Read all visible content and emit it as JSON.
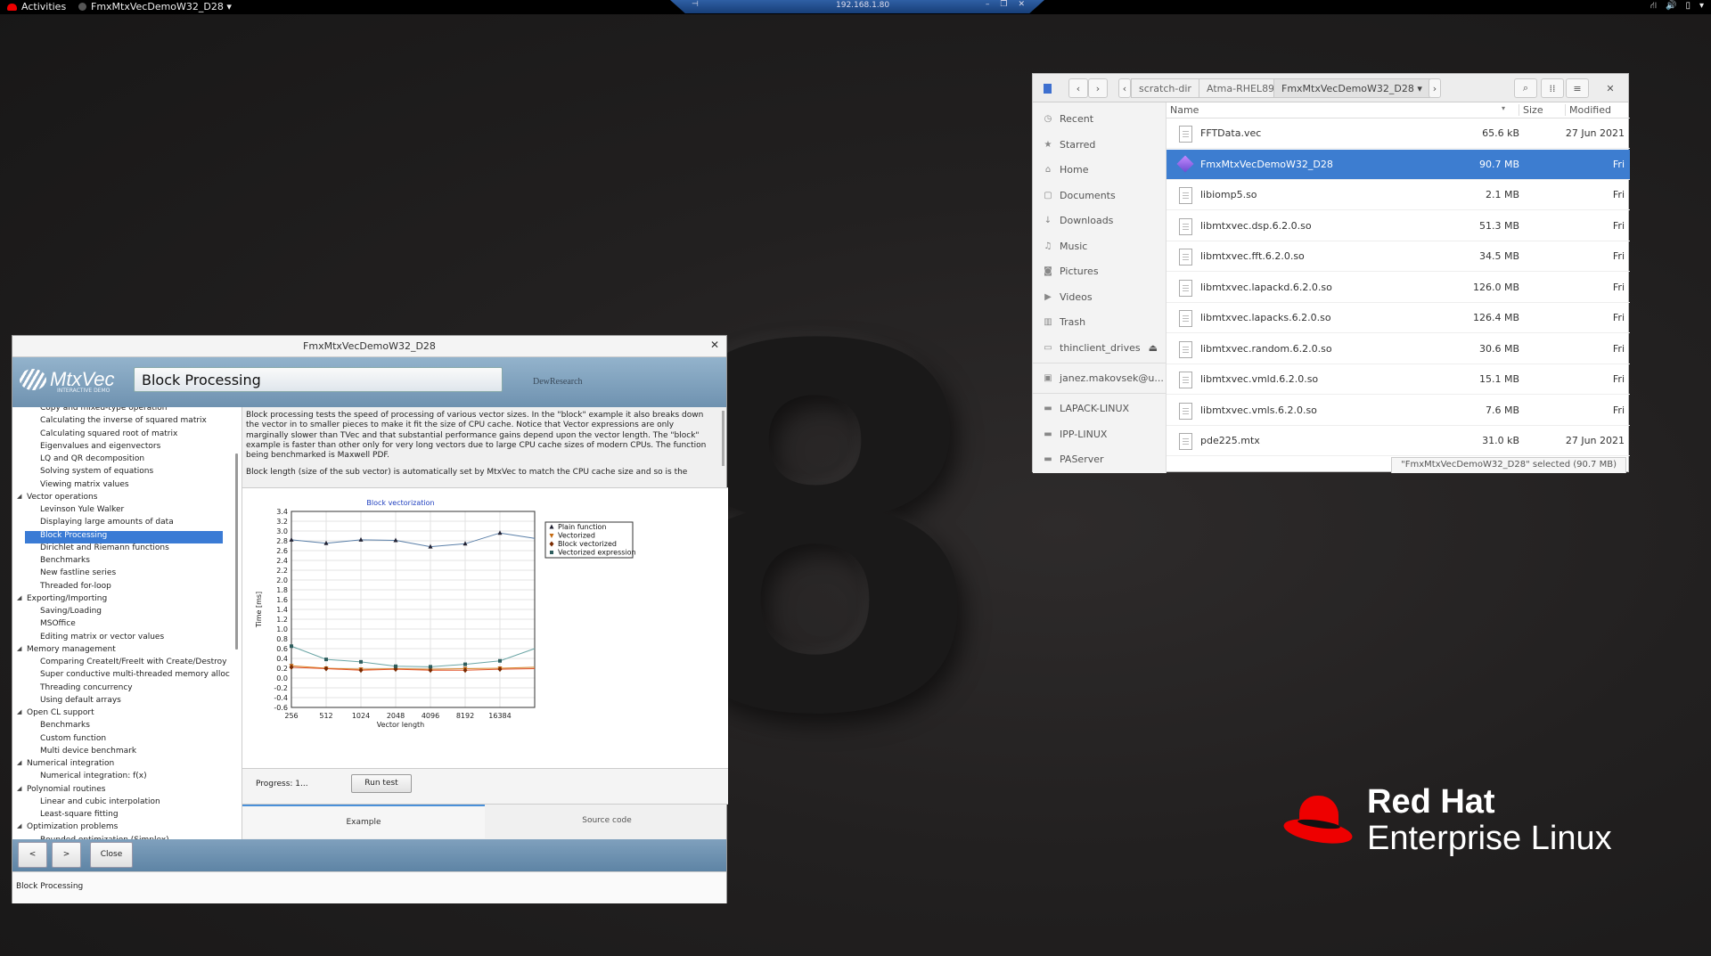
{
  "topbar": {
    "activities": "Activities",
    "app_menu": "FmxMtxVecDemoW32_D28 ▾",
    "icons": [
      "network-icon",
      "volume-icon",
      "battery-icon",
      "system-menu-icon"
    ]
  },
  "rdp": {
    "address": "192.168.1.80"
  },
  "branding": {
    "line1": "Red Hat",
    "line2": "Enterprise Linux",
    "number": "8"
  },
  "file_manager": {
    "breadcrumbs": [
      "scratch-dir",
      "Atma-RHEL89",
      "FmxMtxVecDemoW32_D28 ▾"
    ],
    "sidebar": [
      "Recent",
      "Starred",
      "Home",
      "Documents",
      "Downloads",
      "Music",
      "Pictures",
      "Videos",
      "Trash",
      "thinclient_drives",
      "janez.makovsek@u...",
      "LAPACK-LINUX",
      "IPP-LINUX",
      "PAServer"
    ],
    "columns": {
      "name": "Name",
      "size": "Size",
      "modified": "Modified"
    },
    "files": [
      {
        "name": "FFTData.vec",
        "size": "65.6 kB",
        "modified": "27 Jun 2021"
      },
      {
        "name": "FmxMtxVecDemoW32_D28",
        "size": "90.7 MB",
        "modified": "Fri"
      },
      {
        "name": "libiomp5.so",
        "size": "2.1 MB",
        "modified": "Fri"
      },
      {
        "name": "libmtxvec.dsp.6.2.0.so",
        "size": "51.3 MB",
        "modified": "Fri"
      },
      {
        "name": "libmtxvec.fft.6.2.0.so",
        "size": "34.5 MB",
        "modified": "Fri"
      },
      {
        "name": "libmtxvec.lapackd.6.2.0.so",
        "size": "126.0 MB",
        "modified": "Fri"
      },
      {
        "name": "libmtxvec.lapacks.6.2.0.so",
        "size": "126.4 MB",
        "modified": "Fri"
      },
      {
        "name": "libmtxvec.random.6.2.0.so",
        "size": "30.6 MB",
        "modified": "Fri"
      },
      {
        "name": "libmtxvec.vmld.6.2.0.so",
        "size": "15.1 MB",
        "modified": "Fri"
      },
      {
        "name": "libmtxvec.vmls.6.2.0.so",
        "size": "7.6 MB",
        "modified": "Fri"
      },
      {
        "name": "pde225.mtx",
        "size": "31.0 kB",
        "modified": "27 Jun 2021"
      }
    ],
    "status": "\"FmxMtxVecDemoW32_D28\" selected (90.7 MB)"
  },
  "demo": {
    "window_title": "FmxMtxVecDemoW32_D28",
    "logo": "MtxVec",
    "logo_sub": "INTERACTIVE DEMO",
    "vendor": "DewResearch",
    "header_title": "Block Processing",
    "tree": [
      {
        "t": "Copy and mixed-type operation",
        "k": "sub"
      },
      {
        "t": "Calculating the inverse of squared matrix",
        "k": "sub"
      },
      {
        "t": "Calculating squared root of matrix",
        "k": "sub"
      },
      {
        "t": "Eigenvalues and eigenvectors",
        "k": "sub"
      },
      {
        "t": "LQ and QR decomposition",
        "k": "sub"
      },
      {
        "t": "Solving system of equations",
        "k": "sub"
      },
      {
        "t": "Viewing matrix values",
        "k": "sub"
      },
      {
        "t": "Vector operations",
        "k": "cat"
      },
      {
        "t": "Levinson Yule Walker",
        "k": "sub"
      },
      {
        "t": "Displaying large amounts of data",
        "k": "sub"
      },
      {
        "t": "Block Processing",
        "k": "sel"
      },
      {
        "t": "Dirichlet and Riemann functions",
        "k": "sub"
      },
      {
        "t": "Benchmarks",
        "k": "sub"
      },
      {
        "t": "New fastline series",
        "k": "sub"
      },
      {
        "t": "Threaded for-loop",
        "k": "sub"
      },
      {
        "t": "Exporting/Importing",
        "k": "cat"
      },
      {
        "t": "Saving/Loading",
        "k": "sub"
      },
      {
        "t": "MSOffice",
        "k": "sub"
      },
      {
        "t": "Editing matrix or vector values",
        "k": "sub"
      },
      {
        "t": "Memory management",
        "k": "cat"
      },
      {
        "t": "Comparing CreateIt/FreeIt with Create/Destroy",
        "k": "sub"
      },
      {
        "t": "Super conductive multi-threaded memory alloc",
        "k": "sub"
      },
      {
        "t": "Threading concurrency",
        "k": "sub"
      },
      {
        "t": "Using default arrays",
        "k": "sub"
      },
      {
        "t": "Open CL support",
        "k": "cat"
      },
      {
        "t": "Benchmarks",
        "k": "sub"
      },
      {
        "t": "Custom function",
        "k": "sub"
      },
      {
        "t": "Multi device benchmark",
        "k": "sub"
      },
      {
        "t": "Numerical integration",
        "k": "cat"
      },
      {
        "t": "Numerical integration: f(x)",
        "k": "sub"
      },
      {
        "t": "Polynomial routines",
        "k": "cat"
      },
      {
        "t": "Linear and cubic interpolation",
        "k": "sub"
      },
      {
        "t": "Least-square fitting",
        "k": "sub"
      },
      {
        "t": "Optimization problems",
        "k": "cat"
      },
      {
        "t": "Bounded optimization (Simplex)",
        "k": "sub"
      }
    ],
    "description": "Block processing tests the speed of processing of various vector sizes. In the \"block\" example it also breaks down the vector in to smaller pieces to make it fit the size of CPU cache. Notice that Vector expressions are only marginally slower than TVec and that substantial performance gains depend upon the vector length. The \"block\" example is faster than other only for very long vectors due to large CPU cache sizes of modern CPUs. The function being benchmarked is Maxwell PDF.",
    "description2": "Block length (size of the sub vector) is automatically set by MtxVec to match the CPU cache size and so is the",
    "progress": "Progress: 1...",
    "run_button": "Run test",
    "tabs": [
      "Example",
      "Source code"
    ],
    "nav": {
      "prev": "<",
      "next": ">",
      "close": "Close"
    },
    "status": "Block Processing"
  },
  "chart_data": {
    "type": "line",
    "title": "Block vectorization",
    "xlabel": "Vector length",
    "ylabel": "Time [ms]",
    "categories": [
      "256",
      "512",
      "1024",
      "2048",
      "4096",
      "8192",
      "16384"
    ],
    "ylim": [
      -0.6,
      3.4
    ],
    "yticks": [
      -0.6,
      -0.4,
      -0.2,
      0.0,
      0.2,
      0.4,
      0.6,
      0.8,
      1.0,
      1.2,
      1.4,
      1.6,
      1.8,
      2.0,
      2.2,
      2.4,
      2.6,
      2.8,
      3.0,
      3.2,
      3.4
    ],
    "grid": true,
    "legend_position": "right",
    "series": [
      {
        "name": "Plain function",
        "color": "#5a7fa8",
        "marker": "triangle-up",
        "values": [
          2.82,
          2.75,
          2.82,
          2.81,
          2.68,
          2.74,
          2.96,
          2.85
        ]
      },
      {
        "name": "Vectorized",
        "color": "#d9862a",
        "marker": "triangle-down",
        "values": [
          0.25,
          0.2,
          0.18,
          0.19,
          0.18,
          0.19,
          0.2,
          0.22
        ]
      },
      {
        "name": "Block vectorized",
        "color": "#e2542c",
        "marker": "diamond",
        "values": [
          0.22,
          0.19,
          0.16,
          0.18,
          0.16,
          0.16,
          0.18,
          0.19
        ]
      },
      {
        "name": "Vectorized expression",
        "color": "#6aa5a5",
        "marker": "square",
        "values": [
          0.65,
          0.38,
          0.33,
          0.24,
          0.23,
          0.28,
          0.35,
          0.6
        ]
      }
    ]
  }
}
